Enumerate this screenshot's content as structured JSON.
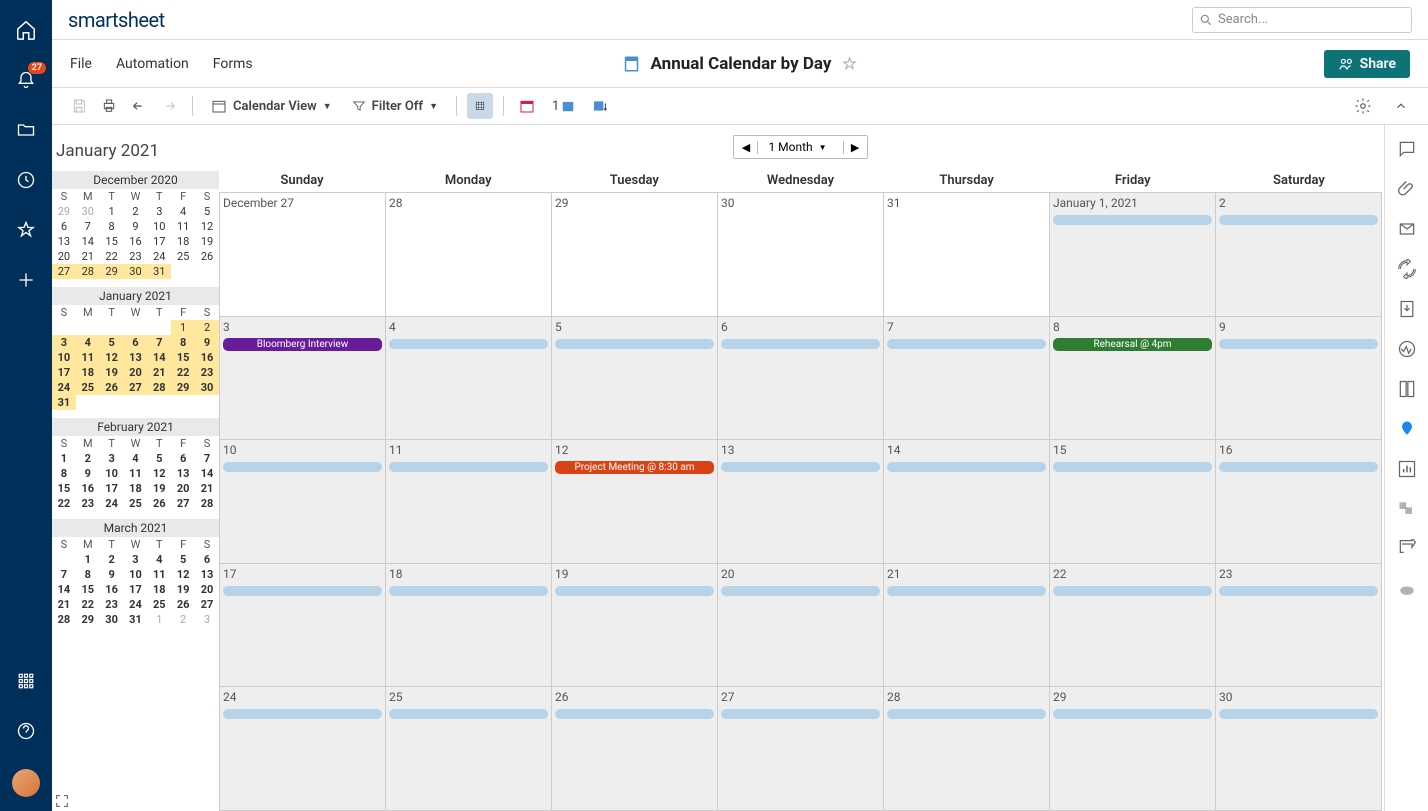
{
  "brand": "smartsheet",
  "search": {
    "placeholder": "Search..."
  },
  "notif_badge": "27",
  "menu": {
    "file": "File",
    "automation": "Automation",
    "forms": "Forms"
  },
  "title": "Annual Calendar by Day",
  "share": "Share",
  "toolbar": {
    "view": "Calendar View",
    "filter": "Filter Off",
    "one": "1"
  },
  "bigTitle": "January 2021",
  "range": "1 Month",
  "dow": [
    "Sunday",
    "Monday",
    "Tuesday",
    "Wednesday",
    "Thursday",
    "Friday",
    "Saturday"
  ],
  "dow_short": [
    "S",
    "M",
    "T",
    "W",
    "T",
    "F",
    "S"
  ],
  "mini": [
    {
      "label": "December 2020",
      "prefix": 2,
      "start": 29,
      "days": 31,
      "hl": [
        27,
        28,
        29,
        30,
        31
      ],
      "bold": []
    },
    {
      "label": "January 2021",
      "prefix": 5,
      "start": 0,
      "days": 31,
      "hl": [
        1,
        2,
        3,
        4,
        5,
        6,
        7,
        8,
        9,
        10,
        11,
        12,
        13,
        14,
        15,
        16,
        17,
        18,
        19,
        20,
        21,
        22,
        23,
        24,
        25,
        26,
        27,
        28,
        29,
        30,
        31
      ],
      "bold": [
        3,
        4,
        5,
        6,
        7,
        8,
        9,
        10,
        11,
        12,
        13,
        14,
        15,
        16,
        17,
        18,
        19,
        20,
        21,
        22,
        23,
        24,
        25,
        26,
        27,
        28,
        29,
        30,
        31
      ]
    },
    {
      "label": "February 2021",
      "prefix": 0,
      "start": 0,
      "days": 28,
      "hl": [],
      "bold": [
        1,
        2,
        3,
        4,
        5,
        6,
        7,
        8,
        9,
        10,
        11,
        12,
        13,
        14,
        15,
        16,
        17,
        18,
        19,
        20,
        21,
        22,
        23,
        24,
        25,
        26,
        27,
        28
      ]
    },
    {
      "label": "March 2021",
      "prefix": 1,
      "start": 0,
      "days": 31,
      "suffix": 3,
      "hl": [],
      "bold": [
        1,
        2,
        3,
        4,
        5,
        6,
        7,
        8,
        9,
        10,
        11,
        12,
        13,
        14,
        15,
        16,
        17,
        18,
        19,
        20,
        21,
        22,
        23,
        24,
        25,
        26,
        27,
        28,
        29,
        30,
        31
      ]
    }
  ],
  "weeks": [
    [
      {
        "l": "December 27",
        "out": true
      },
      {
        "l": "28",
        "out": true
      },
      {
        "l": "29",
        "out": true
      },
      {
        "l": "30",
        "out": true
      },
      {
        "l": "31",
        "out": true
      },
      {
        "l": "January 1, 2021",
        "bar": true
      },
      {
        "l": "2",
        "bar": true
      }
    ],
    [
      {
        "l": "3",
        "ev": {
          "t": "Bloomberg Interview",
          "c": "purple"
        }
      },
      {
        "l": "4",
        "bar": true
      },
      {
        "l": "5",
        "bar": true
      },
      {
        "l": "6",
        "bar": true
      },
      {
        "l": "7",
        "bar": true
      },
      {
        "l": "8",
        "ev": {
          "t": "Rehearsal @ 4pm",
          "c": "green"
        }
      },
      {
        "l": "9",
        "bar": true
      }
    ],
    [
      {
        "l": "10",
        "bar": true
      },
      {
        "l": "11",
        "bar": true
      },
      {
        "l": "12",
        "ev": {
          "t": "Project Meeting @ 8:30 am",
          "c": "orange"
        }
      },
      {
        "l": "13",
        "bar": true
      },
      {
        "l": "14",
        "bar": true
      },
      {
        "l": "15",
        "bar": true
      },
      {
        "l": "16",
        "bar": true
      }
    ],
    [
      {
        "l": "17",
        "bar": true
      },
      {
        "l": "18",
        "bar": true
      },
      {
        "l": "19",
        "bar": true
      },
      {
        "l": "20",
        "bar": true
      },
      {
        "l": "21",
        "bar": true
      },
      {
        "l": "22",
        "bar": true
      },
      {
        "l": "23",
        "bar": true
      }
    ],
    [
      {
        "l": "24",
        "bar": true
      },
      {
        "l": "25",
        "bar": true
      },
      {
        "l": "26",
        "bar": true
      },
      {
        "l": "27",
        "bar": true
      },
      {
        "l": "28",
        "bar": true
      },
      {
        "l": "29",
        "bar": true
      },
      {
        "l": "30",
        "bar": true
      }
    ]
  ]
}
